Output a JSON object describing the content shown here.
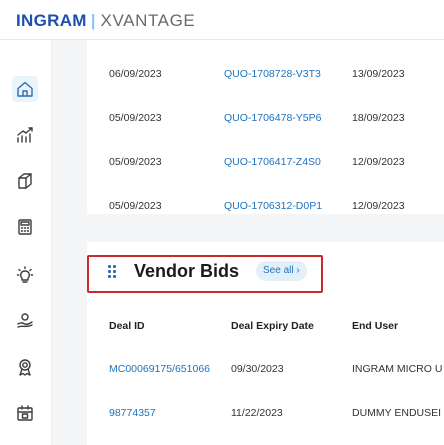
{
  "header": {
    "brand": "INGRAM",
    "separator": "|",
    "product": "XVANTAGE"
  },
  "sidebar": {
    "items": [
      {
        "name": "home",
        "active": true
      },
      {
        "name": "analytics",
        "active": false
      },
      {
        "name": "orders",
        "active": false
      },
      {
        "name": "calculator",
        "active": false
      },
      {
        "name": "ideas",
        "active": false
      },
      {
        "name": "growth",
        "active": false
      },
      {
        "name": "rewards",
        "active": false
      },
      {
        "name": "calendar",
        "active": false
      }
    ]
  },
  "quotes": {
    "rows": [
      {
        "date": "06/09/2023",
        "quote": "QUO-1708728-V3T3",
        "expiry": "13/09/2023"
      },
      {
        "date": "05/09/2023",
        "quote": "QUO-1706478-Y5P6",
        "expiry": "18/09/2023"
      },
      {
        "date": "05/09/2023",
        "quote": "QUO-1706417-Z4S0",
        "expiry": "12/09/2023"
      },
      {
        "date": "05/09/2023",
        "quote": "QUO-1706312-D0P1",
        "expiry": "12/09/2023"
      }
    ]
  },
  "vendor_bids": {
    "title": "Vendor Bids",
    "see_all": "See all ›",
    "columns": [
      "Deal ID",
      "Deal Expiry Date",
      "End User"
    ],
    "rows": [
      {
        "deal_id": "MC00069175/651066",
        "expiry": "09/30/2023",
        "end_user": "INGRAM MICRO U"
      },
      {
        "deal_id": "98774357",
        "expiry": "11/22/2023",
        "end_user": "DUMMY ENDUSEI"
      }
    ]
  },
  "colors": {
    "brand_blue": "#1f4fa8",
    "link_blue": "#1e73be",
    "highlight_red": "#cc2a2a"
  }
}
